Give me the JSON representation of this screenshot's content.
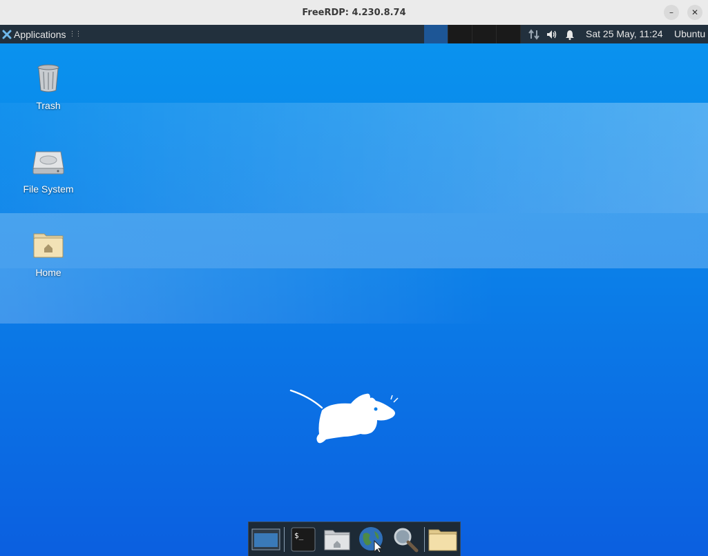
{
  "window": {
    "title": "FreeRDP: 4.230.8.74",
    "minimize_label": "–",
    "close_label": "✕"
  },
  "panel": {
    "applications_label": "Applications",
    "clock": "Sat 25 May, 11:24",
    "user": "Ubuntu",
    "workspaces": 4,
    "active_workspace": 1,
    "tray_icons": [
      "network-icon",
      "volume-icon",
      "notification-bell-icon"
    ]
  },
  "desktop": {
    "icons": [
      {
        "label": "Trash",
        "icon": "trash-icon"
      },
      {
        "label": "File System",
        "icon": "hard-drive-icon"
      },
      {
        "label": "Home",
        "icon": "home-folder-icon"
      }
    ]
  },
  "dock": {
    "items": [
      "show-desktop-icon",
      "terminal-icon",
      "file-manager-icon",
      "web-browser-icon",
      "search-icon",
      "folder-icon"
    ]
  },
  "colors": {
    "desktop_top": "#0a92ee",
    "desktop_bottom": "#0b5fe0",
    "panel_bg": "#22303d",
    "active_workspace": "#1d5696"
  }
}
